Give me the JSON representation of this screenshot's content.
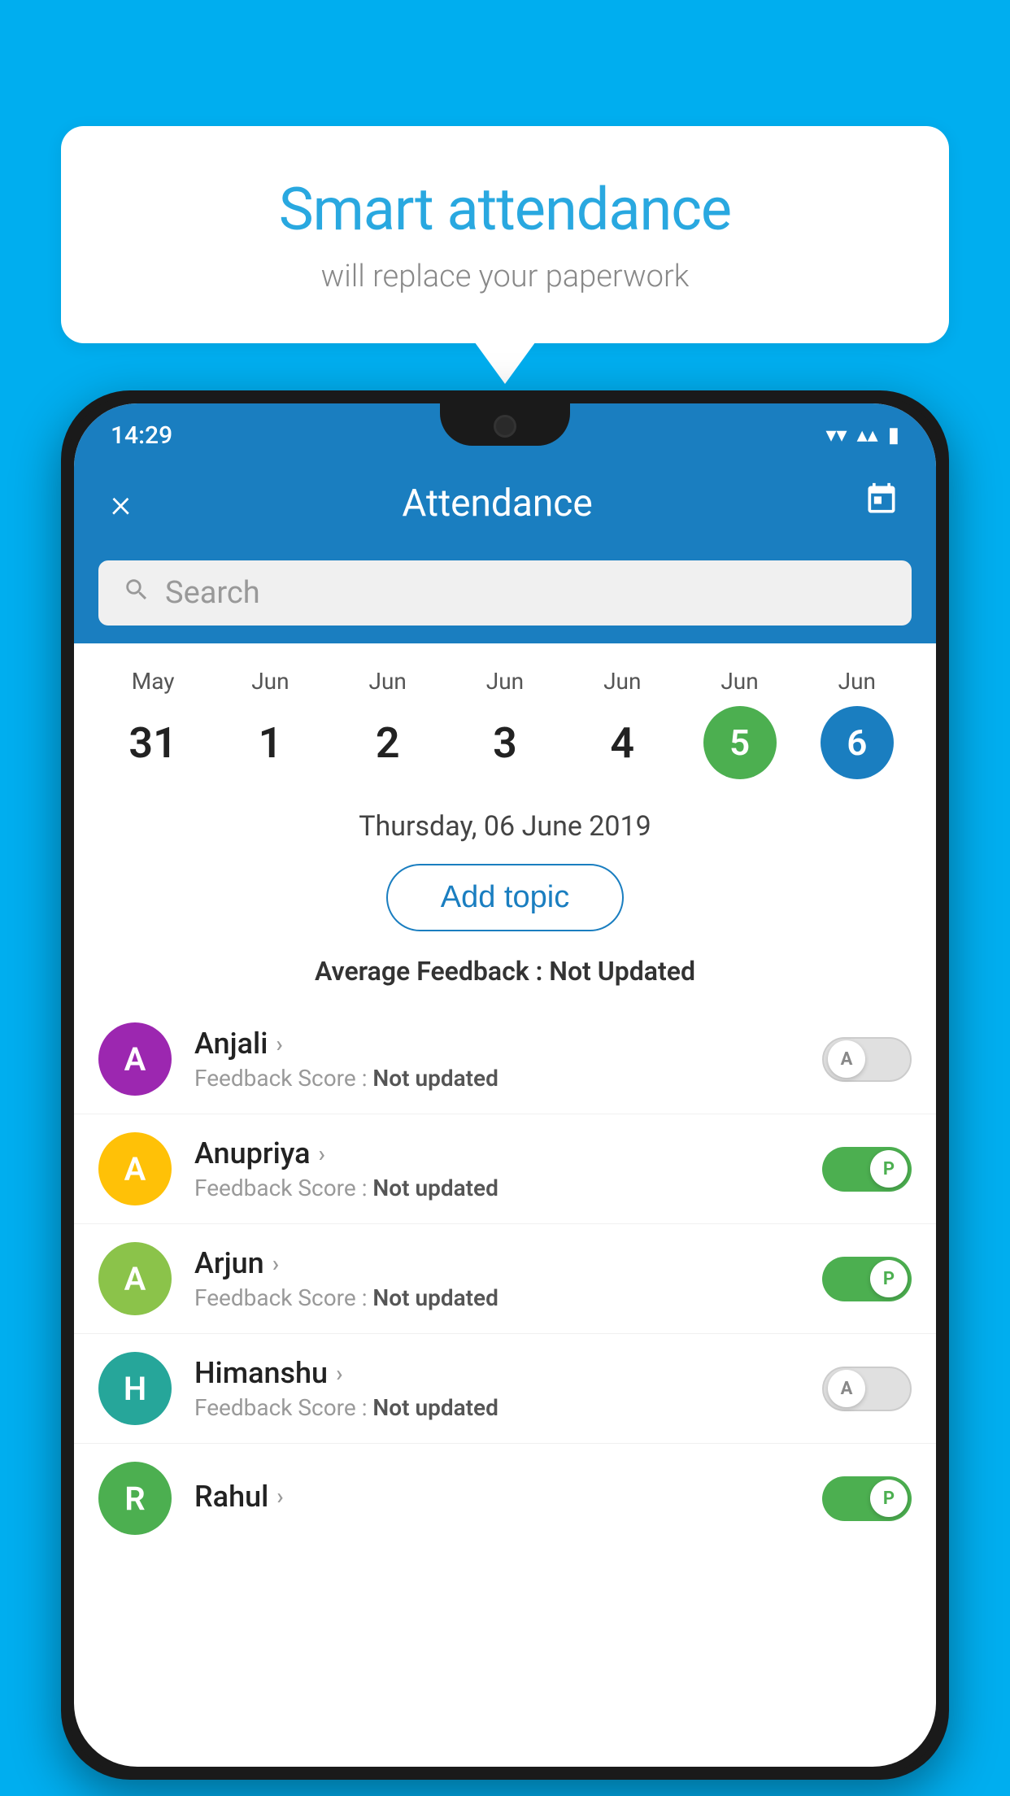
{
  "background_color": "#00AEEF",
  "bubble": {
    "title": "Smart attendance",
    "subtitle": "will replace your paperwork"
  },
  "status_bar": {
    "time": "14:29",
    "wifi": "▾",
    "signal": "▴",
    "battery": "▮"
  },
  "app_bar": {
    "title": "Attendance",
    "close_label": "×",
    "calendar_icon": "📅"
  },
  "search": {
    "placeholder": "Search"
  },
  "calendar": {
    "days": [
      {
        "month": "May",
        "day": "31",
        "highlight": "none"
      },
      {
        "month": "Jun",
        "day": "1",
        "highlight": "none"
      },
      {
        "month": "Jun",
        "day": "2",
        "highlight": "none"
      },
      {
        "month": "Jun",
        "day": "3",
        "highlight": "none"
      },
      {
        "month": "Jun",
        "day": "4",
        "highlight": "none"
      },
      {
        "month": "Jun",
        "day": "5",
        "highlight": "green"
      },
      {
        "month": "Jun",
        "day": "6",
        "highlight": "blue"
      }
    ]
  },
  "selected_date": "Thursday, 06 June 2019",
  "add_topic_label": "Add topic",
  "avg_feedback_label": "Average Feedback :",
  "avg_feedback_value": "Not Updated",
  "students": [
    {
      "name": "Anjali",
      "avatar_letter": "A",
      "avatar_color": "purple",
      "feedback_label": "Feedback Score :",
      "feedback_value": "Not updated",
      "toggle": "off",
      "toggle_letter": "A"
    },
    {
      "name": "Anupriya",
      "avatar_letter": "A",
      "avatar_color": "yellow",
      "feedback_label": "Feedback Score :",
      "feedback_value": "Not updated",
      "toggle": "on",
      "toggle_letter": "P"
    },
    {
      "name": "Arjun",
      "avatar_letter": "A",
      "avatar_color": "light-green",
      "feedback_label": "Feedback Score :",
      "feedback_value": "Not updated",
      "toggle": "on",
      "toggle_letter": "P"
    },
    {
      "name": "Himanshu",
      "avatar_letter": "H",
      "avatar_color": "teal",
      "feedback_label": "Feedback Score :",
      "feedback_value": "Not updated",
      "toggle": "off",
      "toggle_letter": "A"
    },
    {
      "name": "Rahul",
      "avatar_letter": "R",
      "avatar_color": "green",
      "feedback_label": "",
      "feedback_value": "",
      "toggle": "on",
      "toggle_letter": "P"
    }
  ]
}
